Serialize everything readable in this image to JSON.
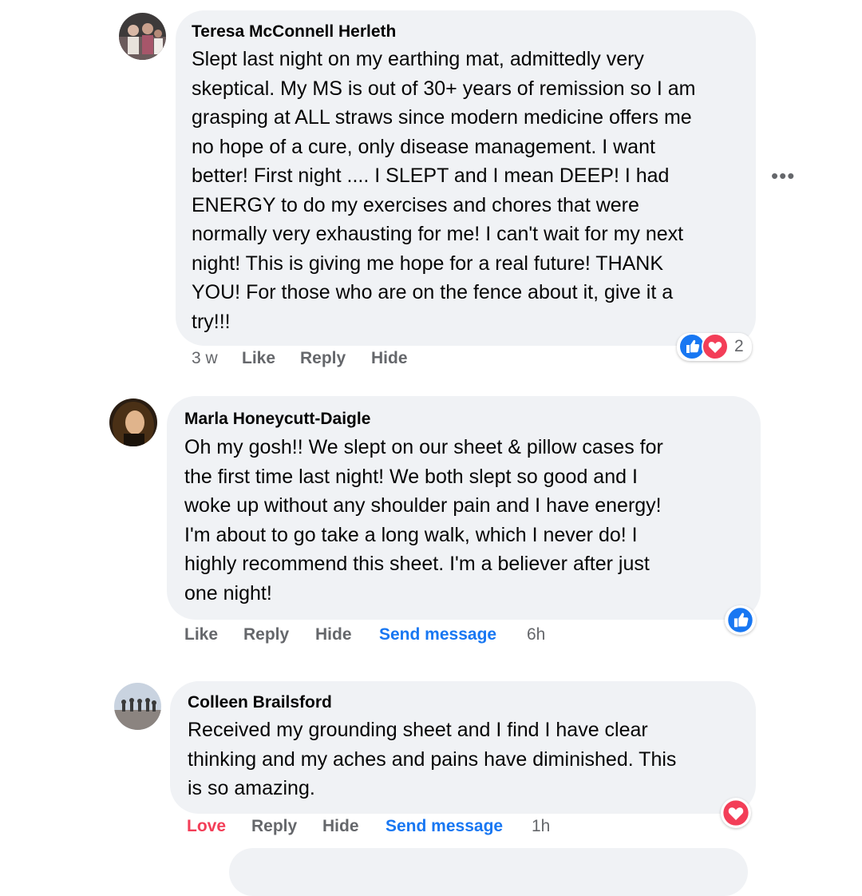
{
  "comments": [
    {
      "author": "Teresa McConnell Herleth",
      "lines": [
        "Slept last night on my earthing mat, admittedly very",
        "skeptical. My MS is out of 30+ years of remission so I am",
        "grasping at ALL straws since modern medicine offers me",
        "no hope of a cure, only disease management. I want",
        "better! First night .... I SLEPT and I mean DEEP! I had",
        "ENERGY to do my exercises and chores that were",
        "normally very exhausting for me! I can't wait for my next",
        "night! This is giving me hope for a real future! THANK",
        "YOU! For those who are on the fence about it, give it a",
        "try!!!"
      ],
      "time": "3 w",
      "like_label": "Like",
      "reply_label": "Reply",
      "hide_label": "Hide",
      "reactions": [
        "like-icon",
        "heart-icon"
      ],
      "reaction_count": "2",
      "more_label": "•••"
    },
    {
      "author": "Marla Honeycutt-Daigle",
      "lines": [
        "Oh my gosh!! We slept on our sheet & pillow cases for",
        "the first time last night! We both slept so good and I",
        "woke up without any shoulder pain and I have energy!",
        "I'm about to go take a long walk, which I never do! I",
        "highly recommend this sheet. I'm a believer after just",
        "one night!"
      ],
      "like_label": "Like",
      "reply_label": "Reply",
      "hide_label": "Hide",
      "send_label": "Send message",
      "time": "6h",
      "reactions": [
        "like-icon"
      ]
    },
    {
      "author": "Colleen Brailsford",
      "lines": [
        "Received my grounding sheet and I find I have clear",
        "thinking and my aches and pains have diminished. This",
        "is so amazing."
      ],
      "love_label": "Love",
      "reply_label": "Reply",
      "hide_label": "Hide",
      "send_label": "Send message",
      "time": "1h",
      "reactions": [
        "heart-icon"
      ]
    }
  ],
  "colors": {
    "bubble": "#f0f2f5",
    "link": "#1877f2",
    "meta": "#65676b",
    "like_blue": "#1877f2",
    "love_red": "#f33e58"
  }
}
